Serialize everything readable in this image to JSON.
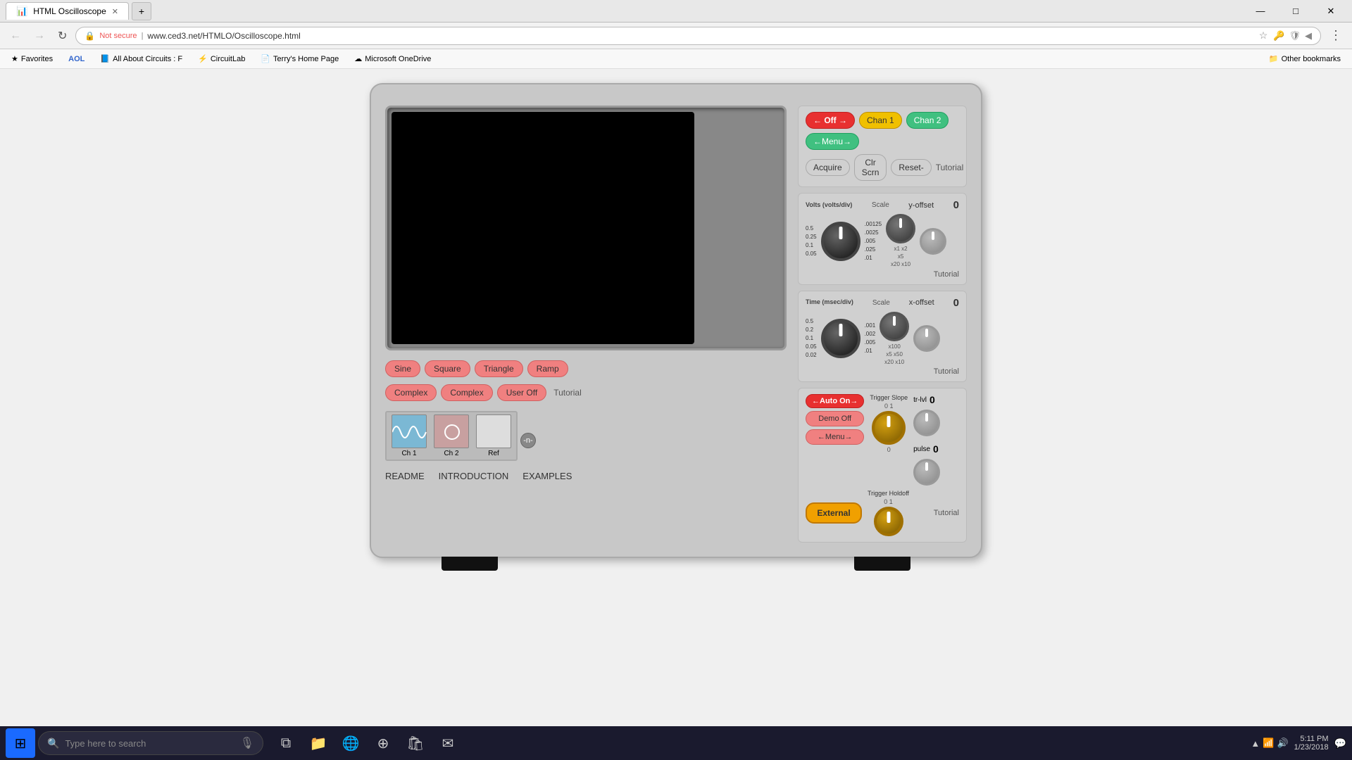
{
  "browser": {
    "tab_title": "HTML Oscilloscope",
    "url": "www.ced3.net/HTMLO/Oscilloscope.html",
    "url_full": "Not secure | www.ced3.net/HTMLO/Oscilloscope.html",
    "bookmarks": [
      {
        "label": "Favorites",
        "icon": "★"
      },
      {
        "label": "AOL",
        "icon": "●"
      },
      {
        "label": "All About Circuits : F",
        "icon": "●"
      },
      {
        "label": "CircuitLab",
        "icon": "⚡"
      },
      {
        "label": "Terry's Home Page",
        "icon": "📄"
      },
      {
        "label": "Microsoft OneDrive",
        "icon": "☁"
      },
      {
        "label": "Other bookmarks",
        "icon": "📁"
      }
    ],
    "win_minimize": "—",
    "win_restore": "□",
    "win_close": "✕"
  },
  "oscilloscope": {
    "buttons": {
      "off": "← Off →",
      "chan1": "Chan 1",
      "chan2": "Chan 2",
      "menu": "←Menu→",
      "acquire": "Acquire",
      "clr_scrn": "Clr Scrn",
      "reset": "Reset-",
      "tutorial": "Tutorial"
    },
    "volts_panel": {
      "title": "Volts (volts/div)",
      "scale_title": "Scale",
      "y_offset_label": "y-offset",
      "y_offset_value": "0",
      "tutorial": "Tutorial",
      "volts_values": [
        "0.5",
        "0.25",
        "0.1",
        "0.05"
      ],
      "scale_values": [
        ".00125",
        ".0025",
        ".005",
        ".025",
        ".01"
      ],
      "scale_mult": [
        "x1",
        "x2",
        "x5",
        "x20",
        "x10"
      ]
    },
    "time_panel": {
      "title": "Time (msec/div)",
      "scale_title": "Scale",
      "x_offset_label": "x-offset",
      "x_offset_value": "0",
      "tutorial": "Tutorial",
      "time_values": [
        "0.5",
        "0.2",
        "0.1",
        "0.05",
        "0.02"
      ],
      "scale_values": [
        ".001",
        ".002",
        ".005",
        ".01"
      ],
      "scale_mult": [
        "x100",
        "x5",
        "x50",
        "x20",
        "x10"
      ]
    },
    "trigger": {
      "auto_on": "←Auto On→",
      "demo_off": "Demo Off",
      "menu": "←Menu→",
      "slope_title": "Trigger Slope",
      "slope_nums_top": "0  1",
      "slope_nums_bot": "0",
      "holdoff_title": "Trigger Holdoff",
      "holdoff_nums": "0  1",
      "trlvl_label": "tr-lvl",
      "trlvl_value": "0",
      "pulse_label": "pulse",
      "pulse_value": "0",
      "external_label": "External",
      "tutorial": "Tutorial"
    },
    "signal_buttons": [
      "Sine",
      "Square",
      "Triangle",
      "Ramp",
      "Complex",
      "Complex",
      "User Off",
      "Tutorial"
    ],
    "channels": {
      "ch1_label": "Ch 1",
      "ch2_label": "Ch 2",
      "ref_label": "Ref"
    },
    "bottom_links": [
      "README",
      "INTRODUCTION",
      "EXAMPLES"
    ],
    "n_button": "-n-"
  },
  "taskbar": {
    "search_placeholder": "Type here to search",
    "time": "5:11 PM",
    "date": "1/23/2018",
    "start_icon": "⊞"
  }
}
